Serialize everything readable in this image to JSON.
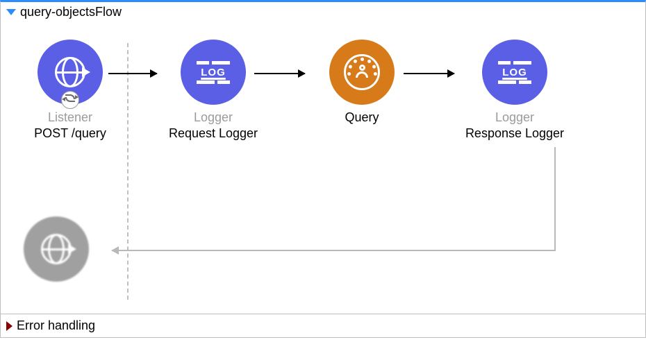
{
  "flow": {
    "title": "query-objectsFlow",
    "nodes": {
      "listener": {
        "type": "Listener",
        "name": "POST /query"
      },
      "reqLogger": {
        "type": "Logger",
        "name": "Request Logger"
      },
      "query": {
        "type": "Query",
        "name": ""
      },
      "respLogger": {
        "type": "Logger",
        "name": "Response Logger"
      }
    }
  },
  "errorSection": {
    "title": "Error handling"
  }
}
